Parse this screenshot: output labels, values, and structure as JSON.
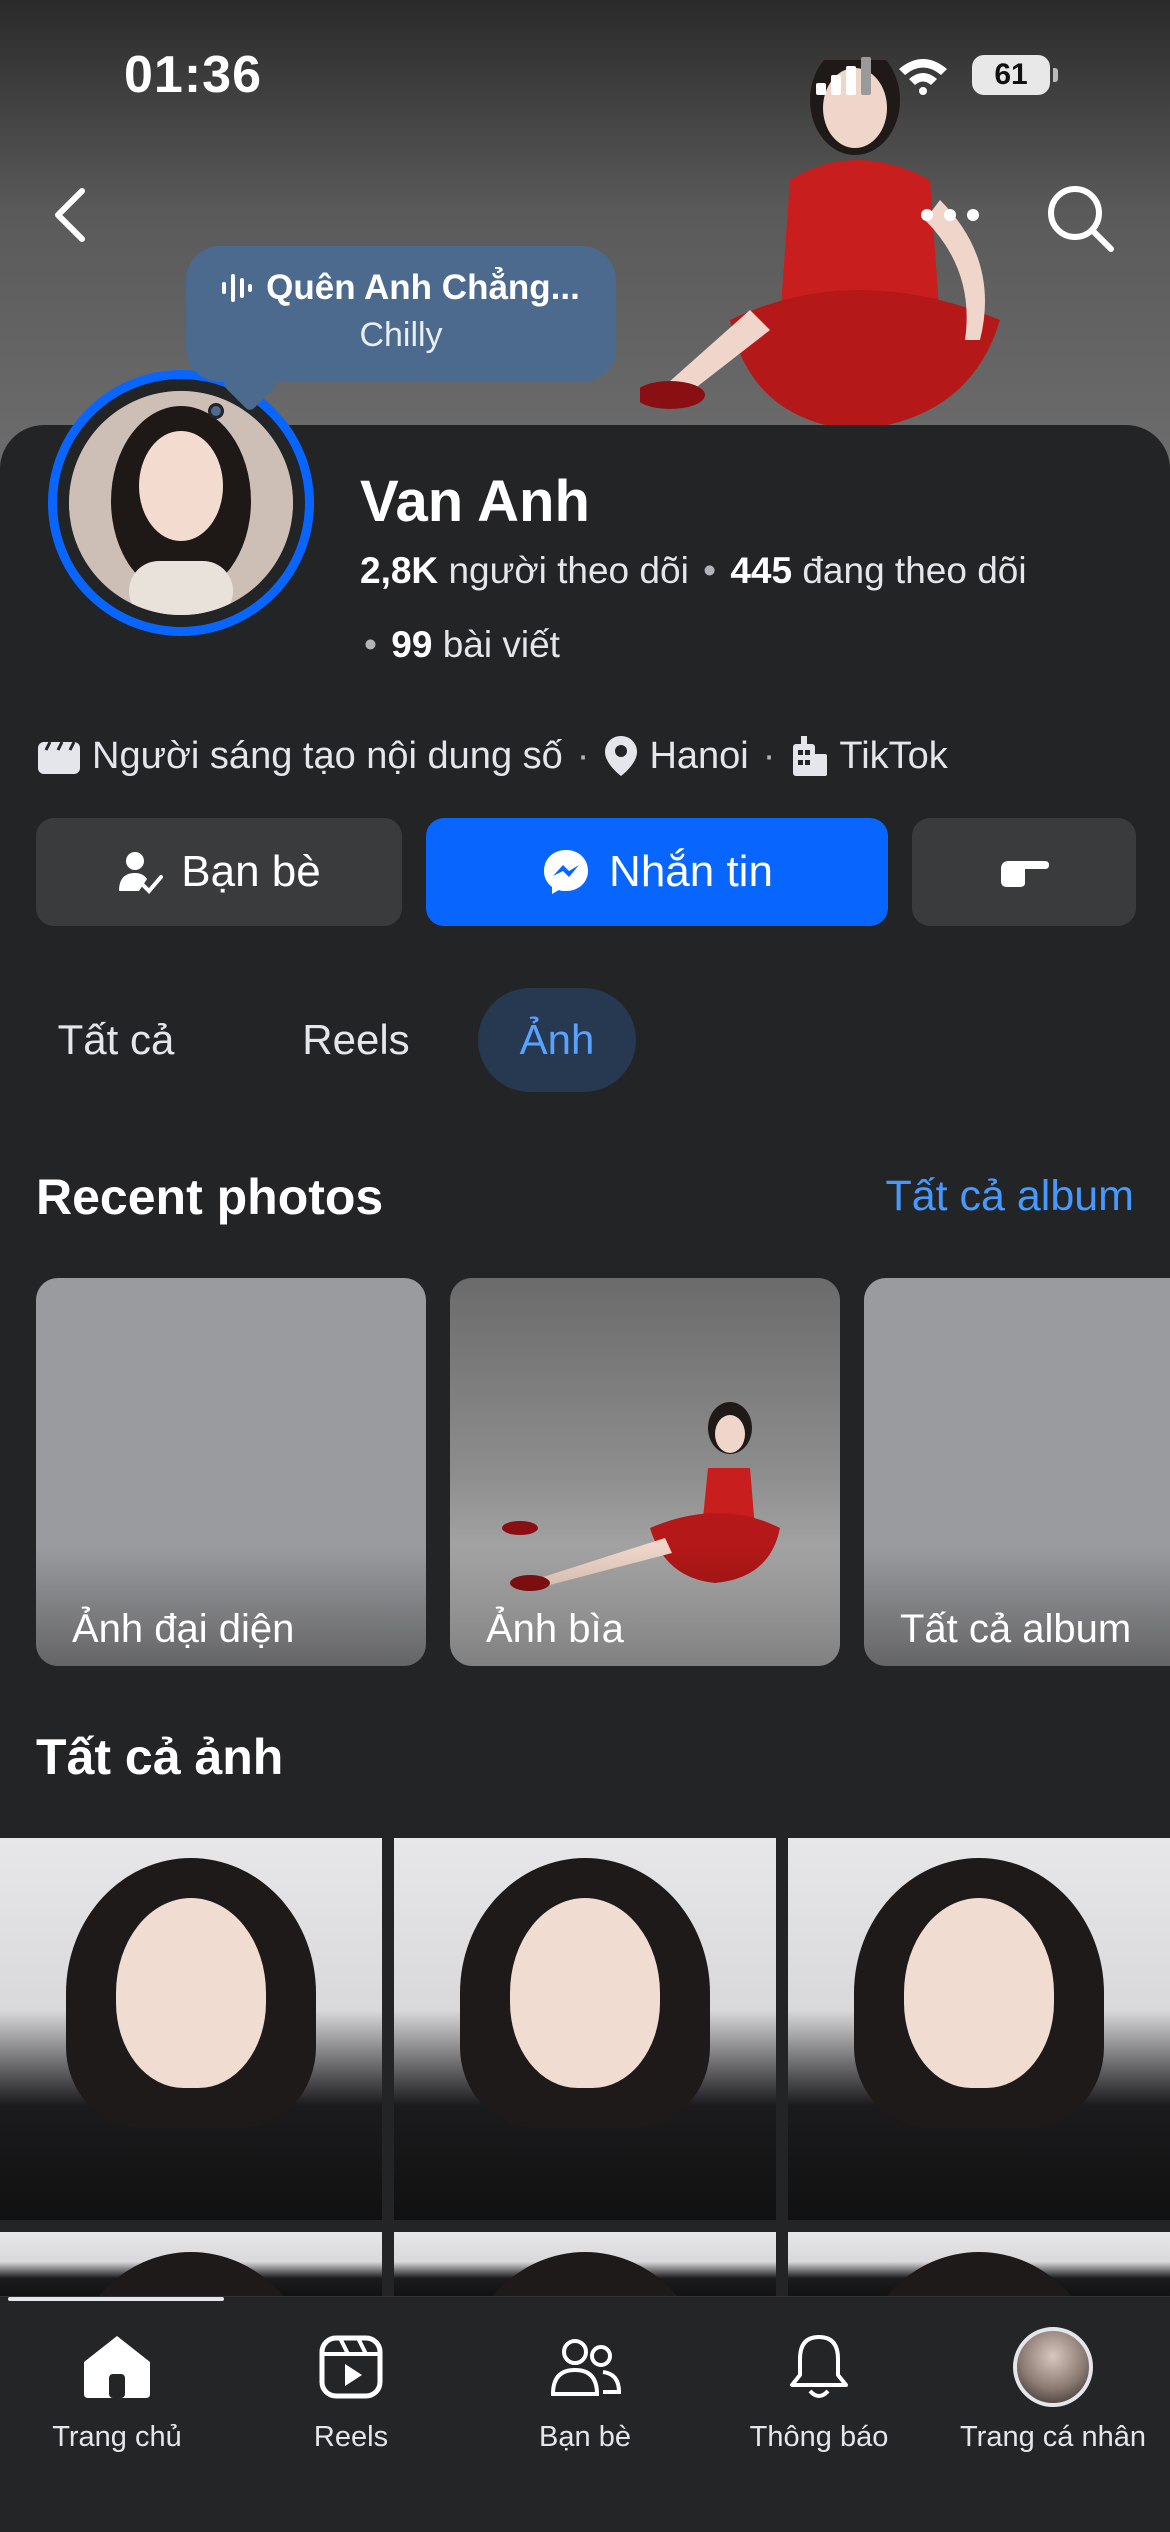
{
  "status": {
    "time": "01:36",
    "battery": "61"
  },
  "music": {
    "title": "Quên Anh Chẳng...",
    "artist": "Chilly"
  },
  "profile": {
    "name": "Van Anh",
    "followers_count": "2,8K",
    "followers_label": "người theo dõi",
    "following_count": "445",
    "following_label": "đang theo dõi",
    "posts_count": "99",
    "posts_label": "bài viết",
    "bullet": "•"
  },
  "info": {
    "category": "Người sáng tạo nội dung số",
    "location": "Hanoi",
    "workplace": "TikTok",
    "separator": "·"
  },
  "actions": {
    "friends_label": "Bạn bè",
    "message_label": "Nhắn tin"
  },
  "tabs": [
    {
      "label": "Tất cả",
      "active": false
    },
    {
      "label": "Reels",
      "active": false
    },
    {
      "label": "Ảnh",
      "active": true
    }
  ],
  "recent": {
    "title": "Recent photos",
    "link": "Tất cả album",
    "albums": [
      {
        "label": "Ảnh đại diện"
      },
      {
        "label": "Ảnh bìa"
      },
      {
        "label": "Tất cả album"
      }
    ]
  },
  "all_photos": {
    "title": "Tất cả ảnh"
  },
  "bottom_nav": [
    {
      "label": "Trang chủ",
      "icon": "home-icon"
    },
    {
      "label": "Reels",
      "icon": "reels-icon"
    },
    {
      "label": "Bạn bè",
      "icon": "friends-icon"
    },
    {
      "label": "Thông báo",
      "icon": "bell-icon"
    },
    {
      "label": "Trang cá nhân",
      "icon": "profile-avatar"
    }
  ],
  "colors": {
    "accent": "#0866ff",
    "background": "#232426",
    "link": "#4599ff",
    "tab_active_bg": "#263951"
  }
}
